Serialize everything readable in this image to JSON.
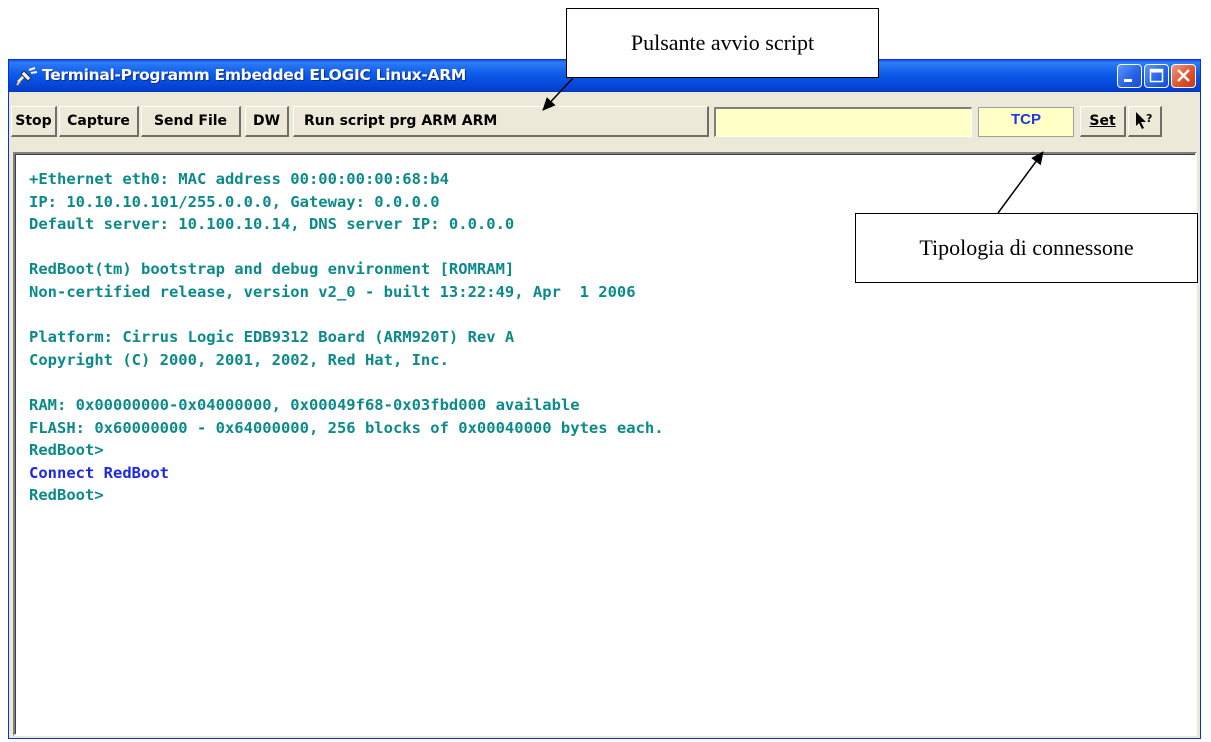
{
  "window": {
    "title": "Terminal-Programm Embedded ELOGIC Linux-ARM",
    "caption_buttons": [
      "minimize",
      "maximize",
      "close"
    ]
  },
  "toolbar": {
    "buttons": [
      {
        "label": "Stop"
      },
      {
        "label": "Capture"
      },
      {
        "label": "Send File"
      },
      {
        "label": "DW"
      },
      {
        "label": "Run script prg ARM ARM"
      }
    ],
    "command_input": {
      "value": ""
    },
    "connection_type": "TCP",
    "set_label": "Set",
    "help_icon": "help-pointer-icon"
  },
  "terminal": {
    "colors": {
      "output": "#0c8a8a",
      "user": "#1c28e6"
    },
    "lines": [
      {
        "text": "+Ethernet eth0: MAC address 00:00:00:00:68:b4",
        "kind": "output"
      },
      {
        "text": "IP: 10.10.10.101/255.0.0.0, Gateway: 0.0.0.0",
        "kind": "output"
      },
      {
        "text": "Default server: 10.100.10.14, DNS server IP: 0.0.0.0",
        "kind": "output"
      },
      {
        "text": "",
        "kind": "output"
      },
      {
        "text": "RedBoot(tm) bootstrap and debug environment [ROMRAM]",
        "kind": "output"
      },
      {
        "text": "Non-certified release, version v2_0 - built 13:22:49, Apr  1 2006",
        "kind": "output"
      },
      {
        "text": "",
        "kind": "output"
      },
      {
        "text": "Platform: Cirrus Logic EDB9312 Board (ARM920T) Rev A",
        "kind": "output"
      },
      {
        "text": "Copyright (C) 2000, 2001, 2002, Red Hat, Inc.",
        "kind": "output"
      },
      {
        "text": "",
        "kind": "output"
      },
      {
        "text": "RAM: 0x00000000-0x04000000, 0x00049f68-0x03fbd000 available",
        "kind": "output"
      },
      {
        "text": "FLASH: 0x60000000 - 0x64000000, 256 blocks of 0x00040000 bytes each.",
        "kind": "output"
      },
      {
        "text": "RedBoot>",
        "kind": "output"
      },
      {
        "text": "Connect RedBoot",
        "kind": "user"
      },
      {
        "text": "RedBoot>",
        "kind": "output"
      }
    ]
  },
  "annotations": {
    "script_button_callout": "Pulsante avvio script",
    "connection_callout": "Tipologia di connessone"
  }
}
